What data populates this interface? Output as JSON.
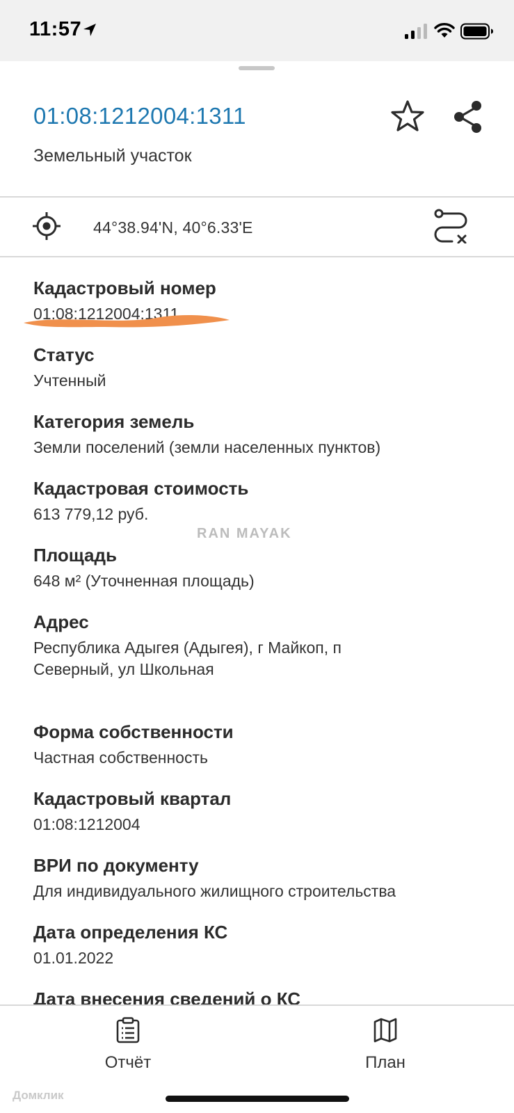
{
  "status_bar": {
    "time": "11:57"
  },
  "header": {
    "title": "01:08:1212004:1311",
    "subtitle": "Земельный участок",
    "star_icon": "star-outline-icon",
    "share_icon": "share-icon"
  },
  "location": {
    "coords": "44°38.94'N, 40°6.33'E",
    "target_icon": "crosshair-icon",
    "route_icon": "route-cancel-icon"
  },
  "fields": [
    {
      "label": "Кадастровый номер",
      "value": "01:08:1212004:1311"
    },
    {
      "label": "Статус",
      "value": "Учтенный"
    },
    {
      "label": "Категория земель",
      "value": "Земли поселений (земли населенных пунктов)"
    },
    {
      "label": "Кадастровая стоимость",
      "value": "613 779,12 руб."
    },
    {
      "label": "Площадь",
      "value": "648 м² (Уточненная площадь)"
    },
    {
      "label": "Адрес",
      "value": "Республика Адыгея (Адыгея), г Майкоп, п",
      "value2": "Северный, ул Школьная"
    },
    {
      "label": "Форма собственности",
      "value": "Частная собственность"
    },
    {
      "label": "Кадастровый квартал",
      "value": "01:08:1212004"
    },
    {
      "label": "ВРИ по документу",
      "value": "Для индивидуального жилищного строительства"
    },
    {
      "label": "Дата определения КС",
      "value": "01.01.2022"
    },
    {
      "label": "Дата внесения сведений о КС"
    }
  ],
  "watermark": "RAN MAYAK",
  "brand": "Домклик",
  "bottom_tabs": [
    {
      "label": "Отчёт",
      "icon": "clipboard-icon"
    },
    {
      "label": "План",
      "icon": "map-icon"
    }
  ],
  "colors": {
    "accent": "#1e78b0",
    "redaction": "#f0904c"
  }
}
